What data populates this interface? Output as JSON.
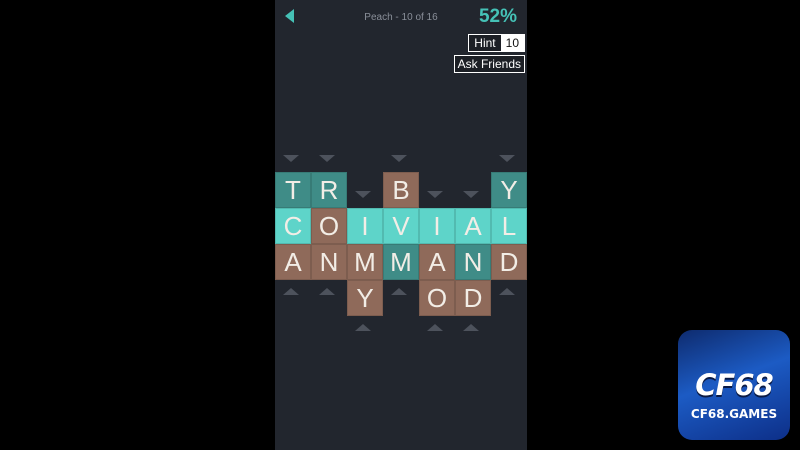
{
  "header": {
    "level_title": "Peach - 10 of 16",
    "percent": "52%",
    "hint_label": "Hint",
    "hint_count": "10",
    "ask_label": "Ask Friends"
  },
  "colors": {
    "teal": "#3f8c87",
    "light_teal": "#5ed4c9",
    "brown": "#8f6a5a",
    "accent": "#45c1b6"
  },
  "board": {
    "row1": [
      "T",
      "R",
      "B",
      "Y"
    ],
    "row2": [
      "C",
      "O",
      "I",
      "V",
      "I",
      "A",
      "L"
    ],
    "row3": [
      "A",
      "N",
      "M",
      "M",
      "A",
      "N",
      "D"
    ],
    "row4": [
      "Y",
      "O",
      "D"
    ]
  },
  "watermark": {
    "big": "CF68",
    "small": "CF68.GAMES"
  }
}
